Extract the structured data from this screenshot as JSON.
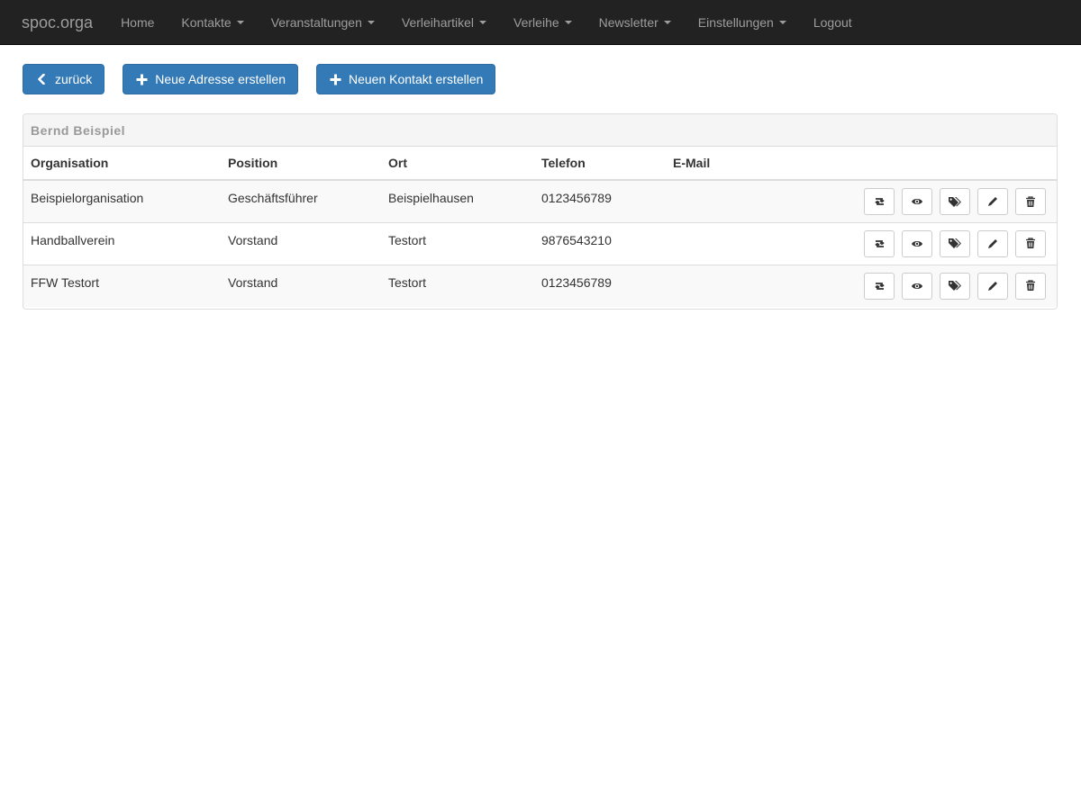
{
  "navbar": {
    "brand": "spoc.orga",
    "items": [
      {
        "label": "Home",
        "dropdown": false
      },
      {
        "label": "Kontakte",
        "dropdown": true
      },
      {
        "label": "Veranstaltungen",
        "dropdown": true
      },
      {
        "label": "Verleihartikel",
        "dropdown": true
      },
      {
        "label": "Verleihe",
        "dropdown": true
      },
      {
        "label": "Newsletter",
        "dropdown": true
      },
      {
        "label": "Einstellungen",
        "dropdown": true
      },
      {
        "label": "Logout",
        "dropdown": false
      }
    ]
  },
  "actions": {
    "back_label": "zurück",
    "new_address_label": "Neue Adresse erstellen",
    "new_contact_label": "Neuen Kontakt erstellen"
  },
  "panel": {
    "title": "Bernd Beispiel",
    "columns": [
      "Organisation",
      "Position",
      "Ort",
      "Telefon",
      "E-Mail"
    ],
    "rows": [
      {
        "organisation": "Beispielorganisation",
        "position": "Geschäftsführer",
        "ort": "Beispielhausen",
        "telefon": "0123456789",
        "email": ""
      },
      {
        "organisation": "Handballverein",
        "position": "Vorstand",
        "ort": "Testort",
        "telefon": "9876543210",
        "email": ""
      },
      {
        "organisation": "FFW Testort",
        "position": "Vorstand",
        "ort": "Testort",
        "telefon": "0123456789",
        "email": ""
      }
    ],
    "row_actions": [
      "retweet-icon",
      "eye-icon",
      "tags-icon",
      "pencil-icon",
      "trash-icon"
    ]
  },
  "colors": {
    "navbar_bg": "#222222",
    "navbar_text": "#9d9d9d",
    "primary": "#337ab7"
  }
}
